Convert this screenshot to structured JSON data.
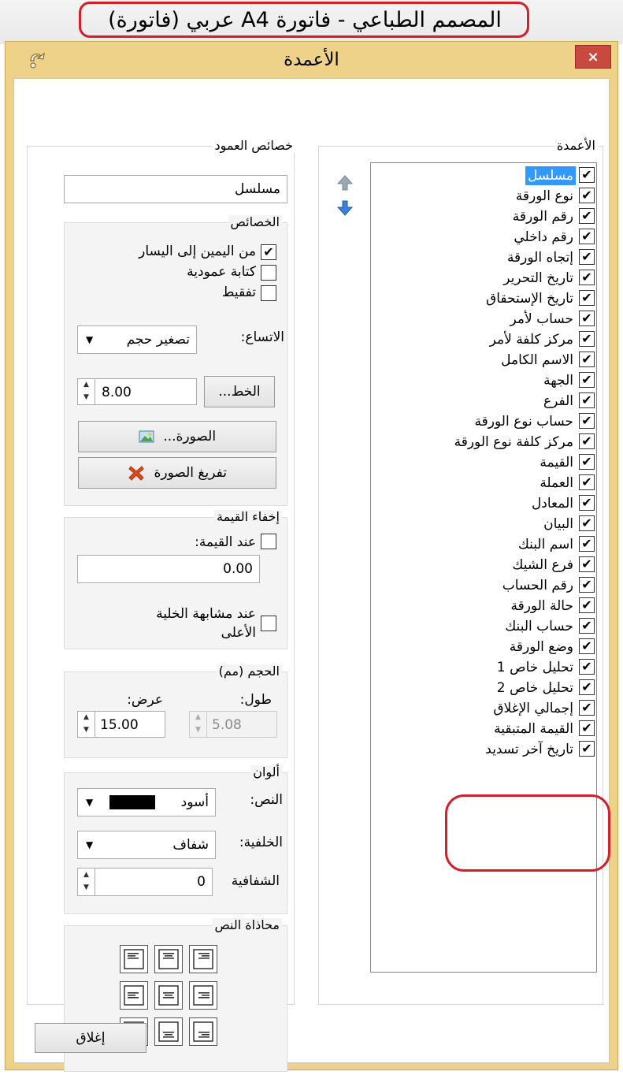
{
  "outer": {
    "title": "المصمم الطباعي - فاتورة A4 عربي (فاتورة)"
  },
  "dialog": {
    "title": "الأعمدة",
    "close_label": "×",
    "close_button_label": "إغلاق"
  },
  "columns": {
    "group_label": "الأعمدة",
    "items": [
      {
        "label": "مسلسل",
        "checked": true,
        "selected": true
      },
      {
        "label": "نوع الورقة",
        "checked": true
      },
      {
        "label": "رقم الورقة",
        "checked": true
      },
      {
        "label": "رقم داخلي",
        "checked": true
      },
      {
        "label": "إتجاه الورقة",
        "checked": true
      },
      {
        "label": "تاريخ التحرير",
        "checked": true
      },
      {
        "label": "تاريخ الإستحقاق",
        "checked": true
      },
      {
        "label": "حساب لأمر",
        "checked": true
      },
      {
        "label": "مركز كلفة لأمر",
        "checked": true
      },
      {
        "label": "الاسم الكامل",
        "checked": true
      },
      {
        "label": "الجهة",
        "checked": true
      },
      {
        "label": "الفرع",
        "checked": true
      },
      {
        "label": "حساب نوع الورقة",
        "checked": true
      },
      {
        "label": "مركز كلفة نوع الورقة",
        "checked": true
      },
      {
        "label": "القيمة",
        "checked": true
      },
      {
        "label": "العملة",
        "checked": true
      },
      {
        "label": "المعادل",
        "checked": true
      },
      {
        "label": "البيان",
        "checked": true
      },
      {
        "label": "اسم البنك",
        "checked": true
      },
      {
        "label": "فرع الشيك",
        "checked": true
      },
      {
        "label": "رقم الحساب",
        "checked": true
      },
      {
        "label": "حالة الورقة",
        "checked": true
      },
      {
        "label": "حساب البنك",
        "checked": true
      },
      {
        "label": "وضع الورقة",
        "checked": true
      },
      {
        "label": "تحليل خاص 1",
        "checked": true
      },
      {
        "label": "تحليل خاص 2",
        "checked": true
      },
      {
        "label": "إجمالي الإغلاق",
        "checked": true
      },
      {
        "label": "القيمة المتبقية",
        "checked": true
      },
      {
        "label": "تاريخ آخر تسديد",
        "checked": true
      }
    ]
  },
  "props": {
    "group_label": "خصائص العمود",
    "column_name": "مسلسل",
    "features": {
      "label": "الخصائص",
      "rtl_label": "من اليمين إلى اليسار",
      "rtl_checked": true,
      "vertical_label": "كتابة عمودية",
      "vertical_checked": false,
      "dotted_label": "تفقيط",
      "dotted_checked": false,
      "fit_label": "الاتساع:",
      "fit_value": "تصغير حجم",
      "font_button": "الخط...",
      "font_size": "8.00",
      "image_button": "الصورة...",
      "clear_image_button": "تفريغ الصورة"
    },
    "hide_value": {
      "label": "إخفاء القيمة",
      "on_value_label": "عند القيمة:",
      "on_value_checked": false,
      "value": "0.00",
      "on_similar_label_1": "عند مشابهة الخلية",
      "on_similar_label_2": "الأعلى",
      "on_similar_checked": false
    },
    "size": {
      "label": "الحجم (مم)",
      "height_label": "طول:",
      "width_label": "عرض:",
      "height_value": "5.08",
      "width_value": "15.00"
    },
    "colors": {
      "label": "ألوان",
      "text_label": "النص:",
      "text_value": "أسود",
      "text_swatch": "#000000",
      "bg_label": "الخلفية:",
      "bg_value": "شفاف",
      "opacity_label": "الشفافية",
      "opacity_value": "0"
    },
    "alignment": {
      "label": "محاذاة النص"
    }
  },
  "ui_colors": {
    "dialog_frame": "#eed28a",
    "selection": "#3399ff",
    "close_button": "#c7493f",
    "annotation_ring": "#d21f2a"
  }
}
